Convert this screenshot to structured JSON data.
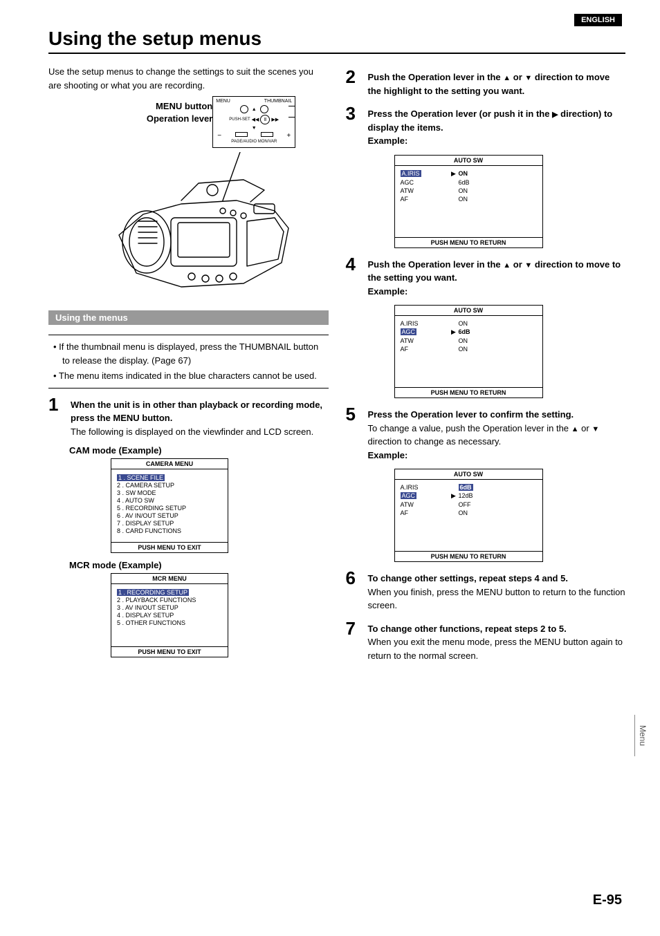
{
  "language_badge": "ENGLISH",
  "page_title": "Using the setup menus",
  "intro": "Use the setup menus to change the settings to suit the scenes you are shooting or what you are recording.",
  "figure_labels": {
    "menu_btn": "MENU button",
    "op_lever": "Operation lever",
    "panel_top_left": "MENU",
    "panel_top_right": "THUMBNAIL",
    "panel_mid": "PUSH-SET",
    "panel_bottom": "PAGE/AUDIO MON/VAR",
    "minus": "−",
    "plus": "+"
  },
  "section_using_menus": "Using the menus",
  "notes": [
    "• If the thumbnail menu is displayed, press the THUMBNAIL button to release the display. (Page 67)",
    "• The menu items indicated in the blue characters cannot be used."
  ],
  "steps": {
    "s1": {
      "lead": "When the unit is in other than playback or recording mode, press the MENU button.",
      "follow": "The following is displayed on the viewfinder and LCD screen."
    },
    "s2": {
      "lead_a": "Push the Operation lever in the ",
      "lead_b": " or ",
      "lead_c": " direction to move the highlight to the setting you want."
    },
    "s3": {
      "lead_a": "Press the Operation lever (or push it in the ",
      "lead_b": " direction) to display the items.",
      "example": "Example:"
    },
    "s4": {
      "lead_a": "Push the Operation lever in the ",
      "lead_b": " or ",
      "lead_c": " direction to move to the setting you want.",
      "example": "Example:"
    },
    "s5": {
      "lead": "Press the Operation lever to confirm the setting.",
      "follow_a": "To change a value, push the Operation lever in the ",
      "follow_b": " or ",
      "follow_c": " direction to change as necessary.",
      "example": "Example:"
    },
    "s6": {
      "lead": "To change other settings, repeat steps 4 and 5.",
      "follow": "When you finish, press the MENU button to return to the function screen."
    },
    "s7": {
      "lead": "To change other functions, repeat steps 2 to 5.",
      "follow": "When you exit the menu mode, press the MENU button again to return to the normal screen."
    }
  },
  "cam_mode_title": "CAM mode (Example)",
  "mcr_mode_title": "MCR mode (Example)",
  "camera_menu": {
    "title": "CAMERA MENU",
    "items": [
      "1 . SCENE FILE",
      "2 . CAMERA SETUP",
      "3 . SW MODE",
      "4 . AUTO SW",
      "5 . RECORDING SETUP",
      "6 . AV IN/OUT SETUP",
      "7 . DISPLAY SETUP",
      "8 . CARD FUNCTIONS"
    ],
    "footer": "PUSH MENU TO EXIT"
  },
  "mcr_menu": {
    "title": "MCR MENU",
    "items": [
      "1 . RECORDING SETUP",
      "2 . PLAYBACK FUNCTIONS",
      "3 . AV IN/OUT SETUP",
      "4 . DISPLAY SETUP",
      "5 . OTHER FUNCTIONS"
    ],
    "footer": "PUSH MENU TO EXIT"
  },
  "auto_sw_common": {
    "title": "AUTO SW",
    "footer": "PUSH  MENU TO RETURN",
    "keys": [
      "A.IRIS",
      "AGC",
      "ATW",
      "AF"
    ]
  },
  "auto_sw_1": {
    "values": [
      "ON",
      "6dB",
      "ON",
      "ON"
    ],
    "sel_row": 0,
    "bold_val": true
  },
  "auto_sw_2": {
    "values": [
      "ON",
      "6dB",
      "ON",
      "ON"
    ],
    "sel_row": 1,
    "bold_val": true
  },
  "auto_sw_3": {
    "values": [
      "6dB",
      "12dB",
      "OFF",
      "ON"
    ],
    "sel_row": 1,
    "val_sel_row": 0
  },
  "side_tab": "Menu",
  "page_number": "E-95"
}
